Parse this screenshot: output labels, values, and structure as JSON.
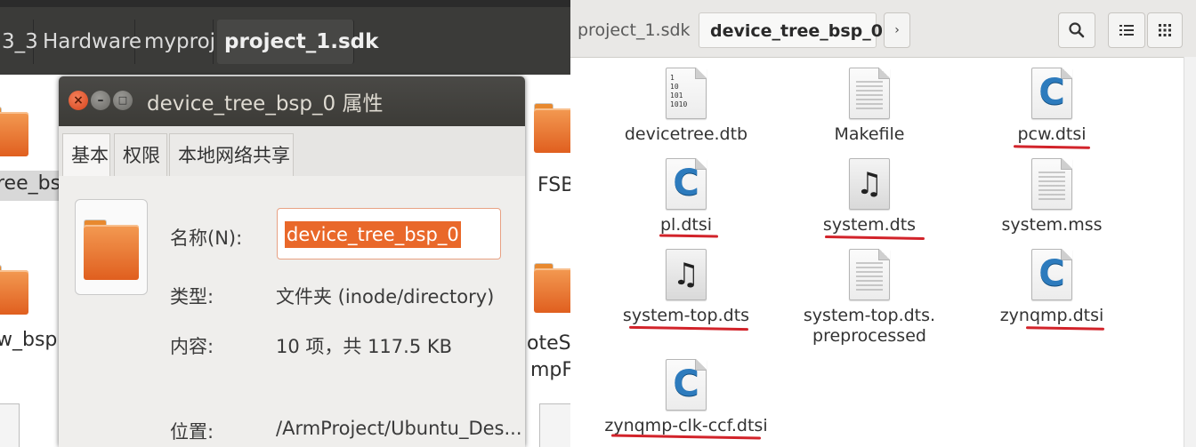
{
  "left_window": {
    "breadcrumbs": [
      "3_3",
      "Hardware",
      "myproj",
      "project_1.sdk"
    ],
    "items": [
      {
        "label": "ree_bsp"
      },
      {
        "label": "w_bsp"
      },
      {
        "label": "FSBl"
      },
      {
        "label": "oteSy"
      },
      {
        "label": "mpFi"
      }
    ]
  },
  "dialog": {
    "title": "device_tree_bsp_0 属性",
    "tabs": [
      "基本",
      "权限",
      "本地网络共享"
    ],
    "name_label": "名称(N):",
    "name_value": "device_tree_bsp_0",
    "type_label": "类型:",
    "type_value": "文件夹 (inode/directory)",
    "contents_label": "内容:",
    "contents_value": "10 项，共 117.5 KB",
    "location_label": "位置:",
    "location_value": "/ArmProject/Ubuntu_Des..."
  },
  "right_window": {
    "breadcrumbs": [
      "project_1.sdk",
      "device_tree_bsp_0"
    ],
    "files": [
      {
        "name": "devicetree.dtb",
        "icon": "binary-file-icon",
        "underlined": false
      },
      {
        "name": "Makefile",
        "icon": "text-file-icon",
        "underlined": false
      },
      {
        "name": "pcw.dtsi",
        "icon": "c-source-icon",
        "underlined": true
      },
      {
        "name": "pl.dtsi",
        "icon": "c-source-icon",
        "underlined": true
      },
      {
        "name": "system.dts",
        "icon": "audio-file-icon",
        "underlined": true
      },
      {
        "name": "system.mss",
        "icon": "text-file-icon",
        "underlined": false
      },
      {
        "name": "system-top.dts",
        "icon": "audio-file-icon",
        "underlined": true
      },
      {
        "name": "system-top.dts.",
        "name_line2": "preprocessed",
        "icon": "text-file-icon",
        "underlined": false
      },
      {
        "name": "zynqmp.dtsi",
        "icon": "c-source-icon",
        "underlined": true
      },
      {
        "name": "zynqmp-clk-ccf.dtsi",
        "icon": "c-source-icon",
        "underlined": true
      }
    ]
  },
  "colors": {
    "accent_orange": "#e9682a",
    "annotation_red": "#d2232a",
    "c_icon_blue": "#2d7bbd"
  }
}
